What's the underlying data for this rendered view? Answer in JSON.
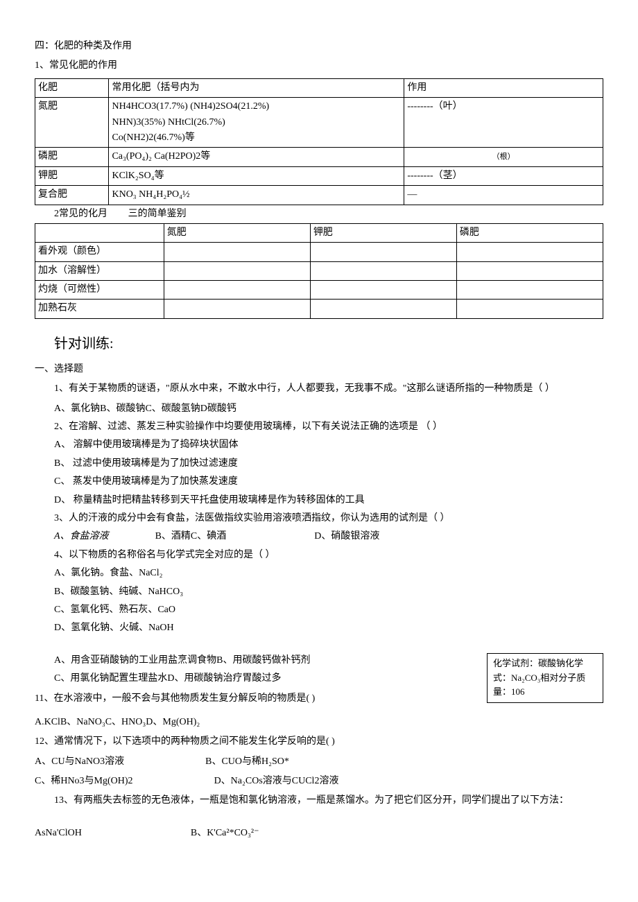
{
  "heading4": "四：化肥的种类及作用",
  "sub1": "1、常见化肥的作用",
  "table1": {
    "h1": "化肥",
    "h2": "常用化肥（括号内为",
    "h3": "作用",
    "r1c1": "氮肥",
    "r1c2a": "NH4HCO3(17.7%)      (NH4)2SO4(21.2%)",
    "r1c2b": "NHN)3(35%)       NHtCl(26.7%)",
    "r1c2c": "Co(NH2)2(46.7%)等",
    "r1c3": "--------（叶）",
    "r2c1": "磷肥",
    "r2c2": "Ca₃(PO₄)₂      Ca(H2PO)2等",
    "r2c3": "（根）",
    "r3c1": "钾肥",
    "r3c2": "KClK₂SO₄等",
    "r3c3": "--------（茎）",
    "r4c1": "复合肥",
    "r4c2": "KNO₃       NH₄H₂PO₄½",
    "r4c3": "—"
  },
  "sub2a": "2常见的化月",
  "sub2b": "三的简单鉴别",
  "table2": {
    "h2": "氮肥",
    "h3": "钾肥",
    "h4": "磷肥",
    "r1": "看外观（颜色）",
    "r2": "加水（溶解性）",
    "r3": "灼烧（可燃性）",
    "r4": "加熟石灰"
  },
  "practice_title": "针对训练:",
  "q_heading": "一、选择题",
  "q1": "1、有关于某物质的谜语，\"原从水中来，不敢水中行，人人都要我，无我事不成。\"这那么谜语所指的一种物质是（               ）",
  "q1_opts": "A、氯化钠B、碳酸钠C、碳酸氢钠D碳酸钙",
  "q2": "2、在溶解、过滤、蒸发三种实验操作中均要使用玻璃棒，以下有关说法正确的选项是                （    ）",
  "q2a": "A、    溶解中使用玻璃棒是为了捣碎块状固体",
  "q2b": "B、    过滤中使用玻璃棒是为了加快过滤速度",
  "q2c": "C、    蒸发中使用玻璃棒是为了加快蒸发速度",
  "q2d": "D、    称量精盐时把精盐转移到天平托盘使用玻璃棒是作为转移固体的工具",
  "q3": "3、人的汗液的成分中会有食盐，法医做指纹实验用溶液喷洒指纹，你认为选用的试剂是（                   ）",
  "q3_opts_a": "A、食盐溶液",
  "q3_opts_b": "B、酒精C、碘酒",
  "q3_opts_d": "D、硝酸银溶液",
  "q4": "4、以下物质的名称俗名与化学式完全对应的是（              ）",
  "q4a": "A、氯化钠。食盐、NaCl₂",
  "q4b": "B、碳酸氢钠、纯碱、NaHCO₃",
  "q4c": "C、氢氧化钙、熟石灰、CaO",
  "q4d": "D、氢氧化钠、火碱、NaOH",
  "reagent_box": "化学试剂：碳酸钠化学式：Na₂CO₃相对分子质量：106",
  "q_extra_ab": "A、用含亚硝酸钠的工业用盐烹调食物B、用碳酸钙做补钙剂",
  "q_extra_cd": "C、用氯化钠配置生理盐水D、用碳酸钠治疗胃酸过多",
  "q11": "11、在水溶液中，一般不会与其他物质发生复分解反响的物质是(             )",
  "q11_opts": "A.KClB、NaNO₃C、HNO₃D、Mg(OH)₂",
  "q12": "12、通常情况下，以下选项中的两种物质之间不能发生化学反响的是(                )",
  "q12a": "A、CU与NaNO3溶液",
  "q12b": "B、CUO与稀H₂SO*",
  "q12c": "C、稀HNo3与Mg(OH)2",
  "q12d": "D、Na₂COs溶液与CUCl2溶液",
  "q13": "13、有两瓶失去标签的无色液体，一瓶是饱和氯化钠溶液，一瓶是蒸馏水。为了把它们区分开，同学们提出了以下方法：",
  "bottom_a": "AsNa'ClOH",
  "bottom_b": "B、K'Ca²*CO₃²⁻"
}
